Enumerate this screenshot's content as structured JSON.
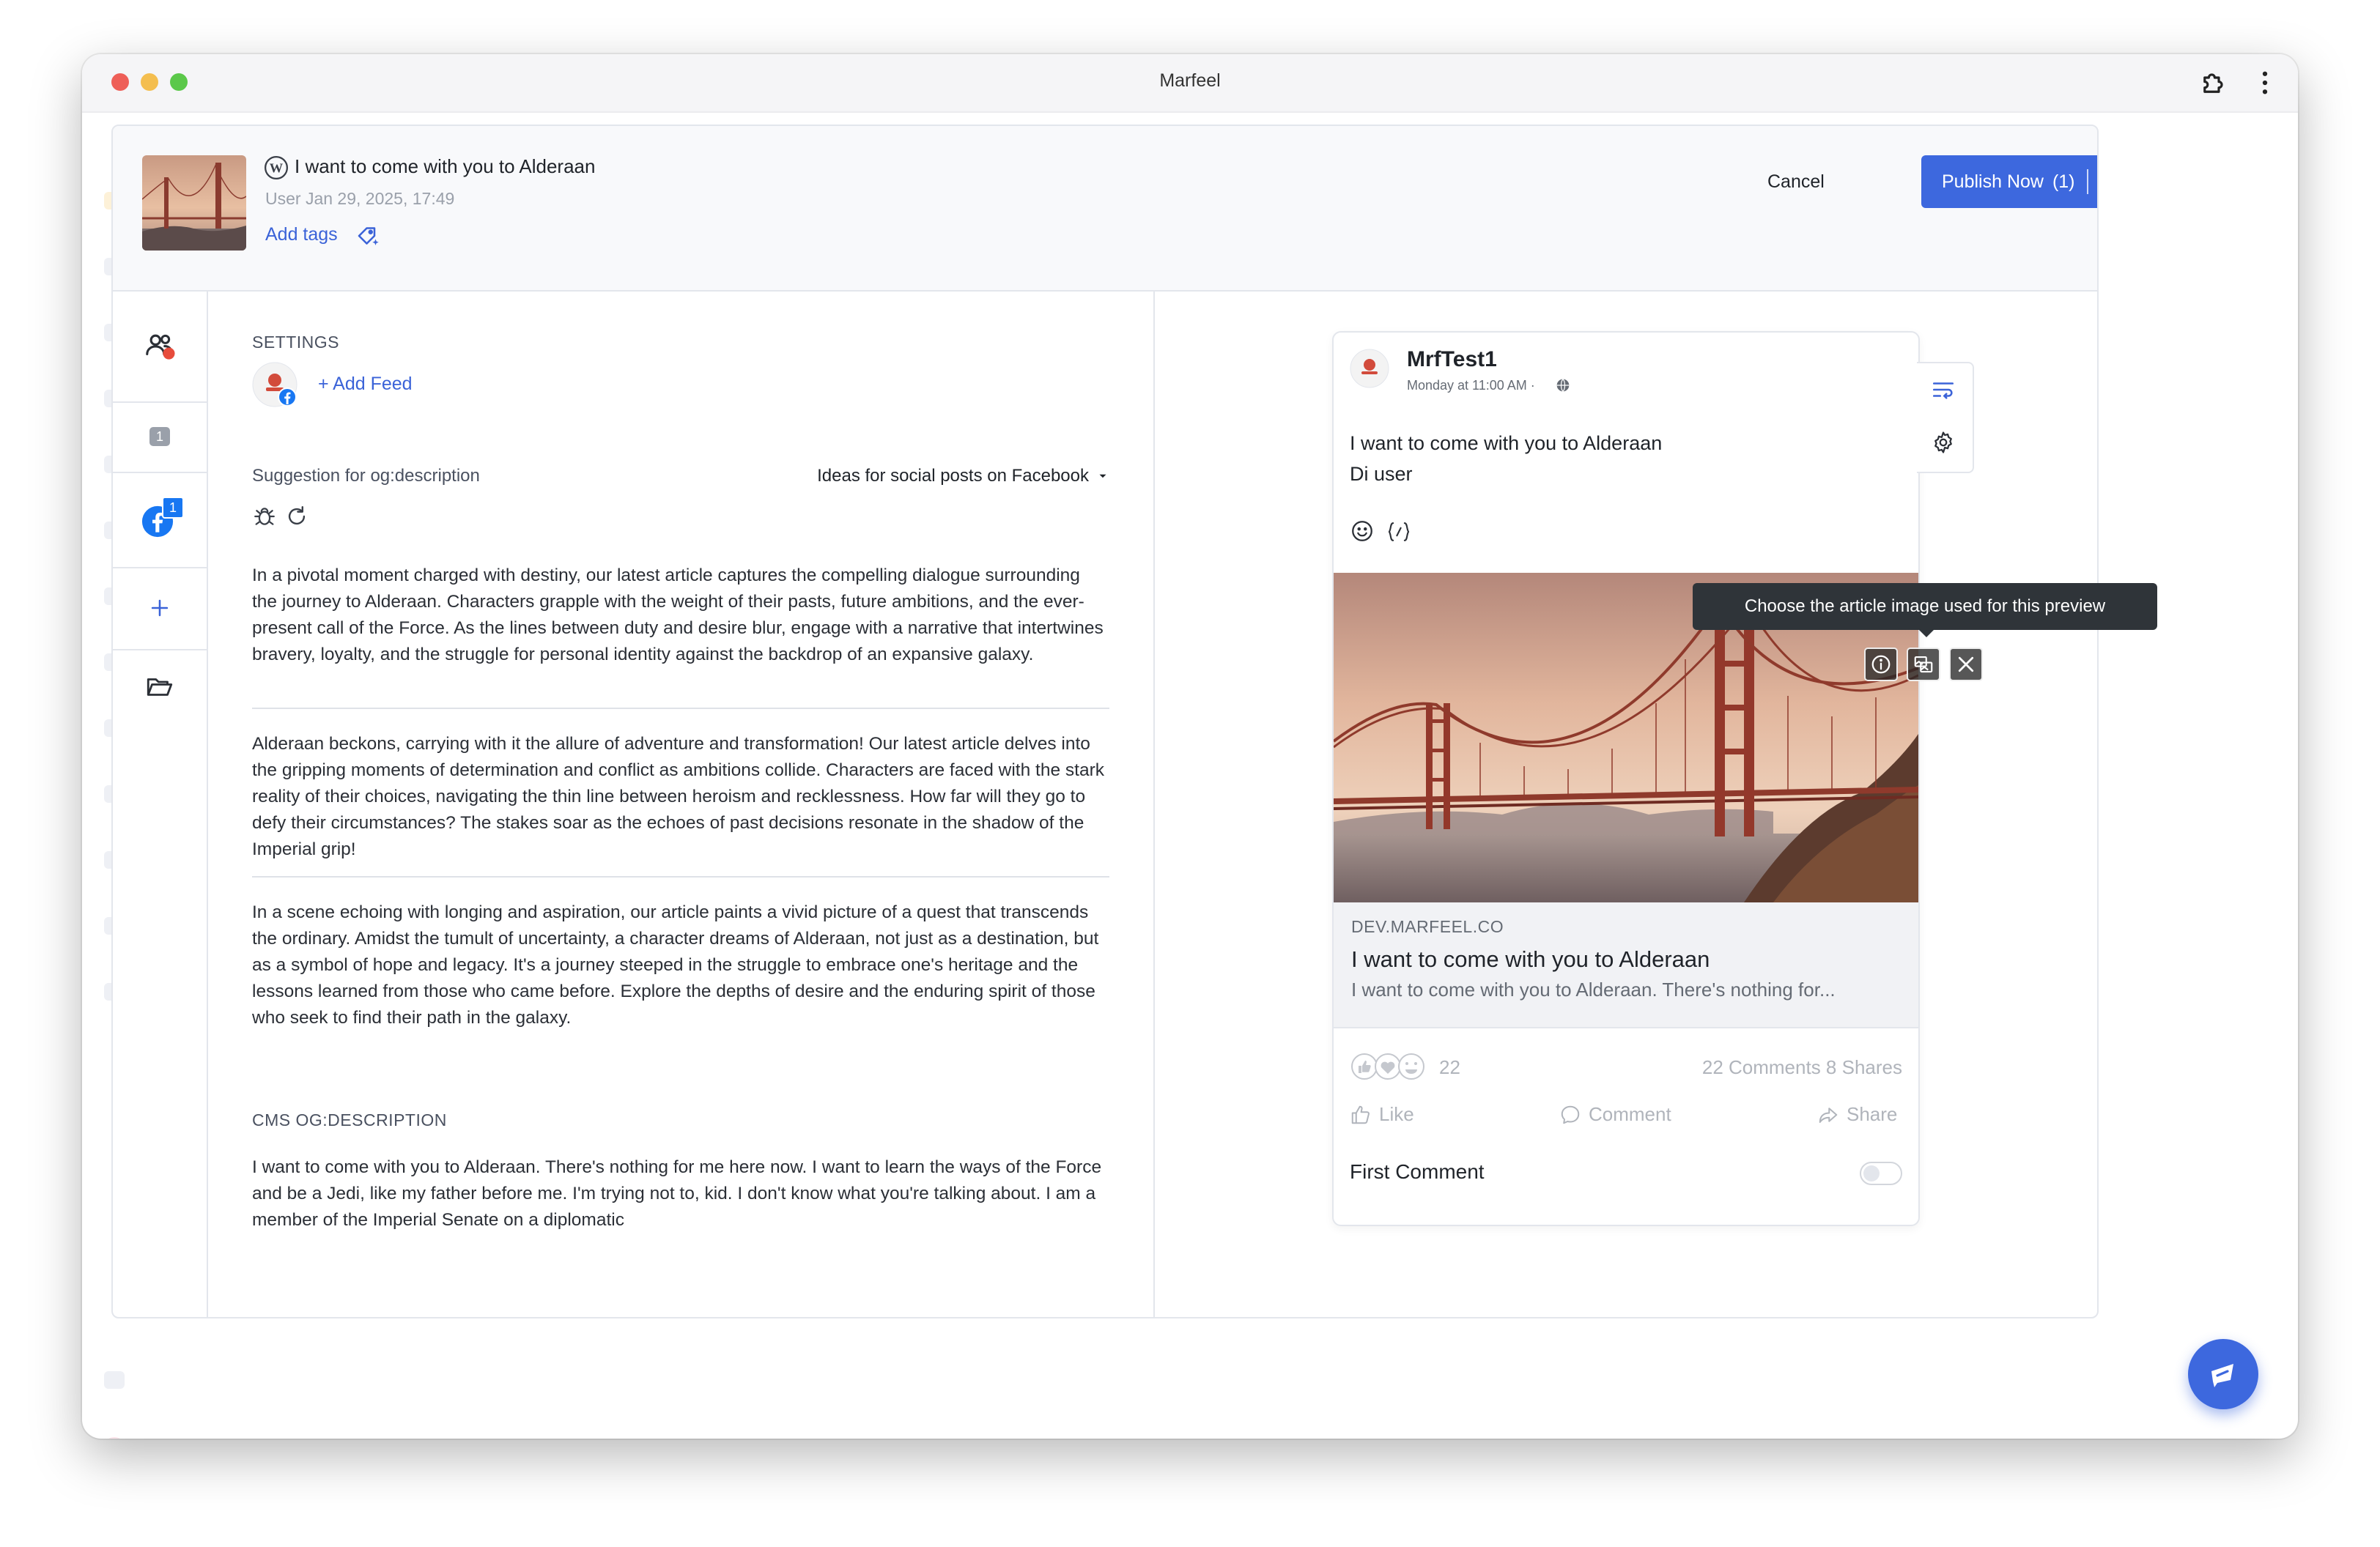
{
  "window": {
    "title": "Marfeel"
  },
  "header": {
    "article_title": "I want to come with you to Alderaan",
    "meta": "User  Jan 29, 2025, 17:49",
    "add_tags": "Add tags",
    "cancel": "Cancel",
    "publish_label": "Publish Now",
    "publish_count": "(1)"
  },
  "rail": {
    "items": [
      {
        "icon": "users-alert-icon"
      },
      {
        "icon": "number-badge-icon",
        "badge": "1"
      },
      {
        "icon": "facebook-icon",
        "badge": "1"
      },
      {
        "icon": "plus-icon"
      },
      {
        "icon": "folder-open-icon"
      }
    ]
  },
  "settings": {
    "section_label": "SETTINGS",
    "add_feed": "+ Add Feed",
    "suggestion_label": "Suggestion for og:description",
    "ideas_select": "Ideas for social posts on Facebook",
    "suggestions": [
      "In a pivotal moment charged with destiny, our latest article captures the compelling dialogue surrounding the journey to Alderaan. Characters grapple with the weight of their pasts, future ambitions, and the ever-present call of the Force. As the lines between duty and desire blur, engage with a narrative that intertwines bravery, loyalty, and the struggle for personal identity against the backdrop of an expansive galaxy.",
      "Alderaan beckons, carrying with it the allure of adventure and transformation! Our latest article delves into the gripping moments of determination and conflict as ambitions collide. Characters are faced with the stark reality of their choices, navigating the thin line between heroism and recklessness. How far will they go to defy their circumstances? The stakes soar as the echoes of past decisions resonate in the shadow of the Imperial grip!",
      "In a scene echoing with longing and aspiration, our article paints a vivid picture of a quest that transcends the ordinary. Amidst the tumult of uncertainty, a character dreams of Alderaan, not just as a destination, but as a symbol of hope and legacy. It's a journey steeped in the struggle to embrace one's heritage and the lessons learned from those who came before. Explore the depths of desire and the enduring spirit of those who seek to find their path in the galaxy."
    ],
    "cms_label": "CMS OG:DESCRIPTION",
    "cms_text": "I want to come with you to Alderaan. There's nothing for me here now. I want to learn the ways of the Force and be a Jedi, like my father before me. I'm trying not to, kid. I don't know what you're talking about. I am a member of the Imperial Senate on a diplomatic"
  },
  "preview": {
    "page_name": "MrfTest1",
    "post_time": "Monday at 11:00 AM ·",
    "post_line1": "I want to come with you to Alderaan",
    "post_line2": "Di user",
    "tooltip": "Choose the article image used for this preview",
    "link_domain": "DEV.MARFEEL.CO",
    "link_title": "I want to come with you to Alderaan",
    "link_desc": "I want to come with you to Alderaan. There's nothing for...",
    "reaction_count": "22",
    "comments_shares": "22 Comments 8 Shares",
    "like": "Like",
    "comment": "Comment",
    "share": "Share",
    "first_comment": "First Comment",
    "first_comment_enabled": false
  },
  "colors": {
    "accent": "#3d68de",
    "link": "#3b63d8",
    "facebook": "#1877f2",
    "alert": "#e74c3c",
    "tooltip_bg": "#2f3439"
  }
}
